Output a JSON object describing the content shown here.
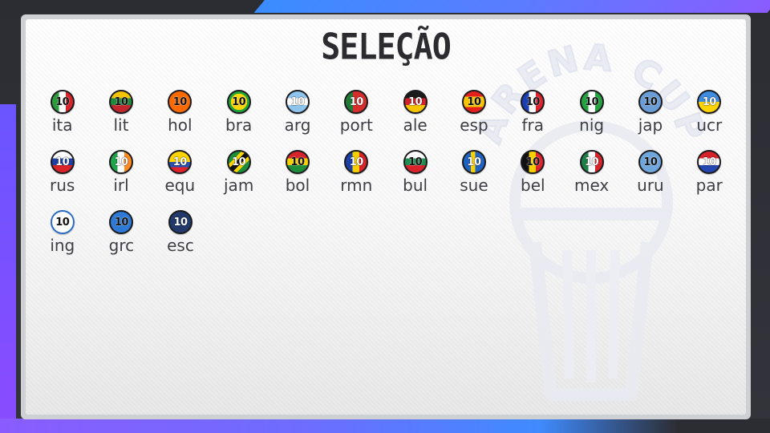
{
  "title": "SELEÇÃO",
  "watermark_text": "ARENA CUP",
  "teams": [
    {
      "code": "ita",
      "number": "10",
      "flag": "linear-gradient(90deg,#2a9d3a 0 33%,#ffffff 33% 66%,#d8232a 66%)",
      "light": false
    },
    {
      "code": "lit",
      "number": "10",
      "flag": "linear-gradient(180deg,#f5c400 0 33%,#1e8a3a 33% 66%,#c1272d 66%)",
      "light": false
    },
    {
      "code": "hol",
      "number": "10",
      "flag": "linear-gradient(180deg,#ff6a00 0 100%)",
      "light": false
    },
    {
      "code": "bra",
      "number": "10",
      "flag": "radial-gradient(circle,#ffd400 0 55%,#1fa53a 56%)",
      "light": false
    },
    {
      "code": "arg",
      "number": "10",
      "flag": "linear-gradient(180deg,#8fc4ec 0 33%,#ffffff 33% 66%,#8fc4ec 66%)",
      "light": true
    },
    {
      "code": "port",
      "number": "10",
      "flag": "linear-gradient(90deg,#1e7a35 0 35%,#d62f2b 35%)",
      "light": true
    },
    {
      "code": "ale",
      "number": "10",
      "flag": "linear-gradient(180deg,#1a1a1a 0 33%,#d42128 33% 66%,#f7c500 66%)",
      "light": true
    },
    {
      "code": "esp",
      "number": "10",
      "flag": "linear-gradient(180deg,#e3201b 0 25%,#f7c600 25% 75%,#e3201b 75%)",
      "light": false
    },
    {
      "code": "fra",
      "number": "10",
      "flag": "linear-gradient(90deg,#1a3fb4 0 33%,#ffffff 33% 66%,#e0232b 66%)",
      "light": false
    },
    {
      "code": "nig",
      "number": "10",
      "flag": "linear-gradient(90deg,#23a33f 0 33%,#ffffff 33% 66%,#23a33f 66%)",
      "light": false
    },
    {
      "code": "jap",
      "number": "10",
      "flag": "linear-gradient(180deg,#6b9ed6 0 100%)",
      "light": false
    },
    {
      "code": "ucr",
      "number": "10",
      "flag": "linear-gradient(180deg,#3d8ce0 0 50%,#ffd400 50%)",
      "light": true
    },
    {
      "code": "rus",
      "number": "10",
      "flag": "linear-gradient(180deg,#ffffff 0 33%,#1c3fa8 33% 66%,#d8232a 66%)",
      "light": true
    },
    {
      "code": "irl",
      "number": "10",
      "flag": "linear-gradient(90deg,#1fa54a 0 33%,#ffffff 33% 66%,#ff8a1f 66%)",
      "light": true
    },
    {
      "code": "equ",
      "number": "10",
      "flag": "linear-gradient(180deg,#ffd400 0 50%,#2750b0 50% 75%,#e0232b 75%)",
      "light": true
    },
    {
      "code": "jam",
      "number": "10",
      "flag": "linear-gradient(135deg,#1d8f3a 0 30%,#ffd400 30% 42%,#111 42% 58%,#ffd400 58% 70%,#1d8f3a 70%)",
      "light": true
    },
    {
      "code": "bol",
      "number": "10",
      "flag": "linear-gradient(180deg,#d8232a 0 33%,#f7d000 33% 66%,#1f8e3a 66%)",
      "light": false
    },
    {
      "code": "rmn",
      "number": "10",
      "flag": "linear-gradient(90deg,#1a3fa8 0 33%,#f7d000 33% 66%,#d8232a 66%)",
      "light": true
    },
    {
      "code": "bul",
      "number": "10",
      "flag": "linear-gradient(180deg,#ffffff 0 33%,#1b8f4f 33% 66%,#d8232a 66%)",
      "light": false
    },
    {
      "code": "sue",
      "number": "10",
      "flag": "linear-gradient(90deg,#1f64c2 0 35%,#ffd000 35% 55%,#1f64c2 55%)",
      "light": true
    },
    {
      "code": "bel",
      "number": "10",
      "flag": "linear-gradient(90deg,#111 0 33%,#f7d000 33% 66%,#e0232b 66%)",
      "light": false
    },
    {
      "code": "mex",
      "number": "10",
      "flag": "linear-gradient(90deg,#1c7f45 0 33%,#ffffff 33% 66%,#d8232a 66%)",
      "light": true
    },
    {
      "code": "uru",
      "number": "10",
      "flag": "linear-gradient(180deg,#6fa6dc 0 100%)",
      "light": false
    },
    {
      "code": "par",
      "number": "10",
      "flag": "linear-gradient(180deg,#d8232a 0 33%,#ffffff 33% 66%,#2448b0 66%)",
      "light": true
    },
    {
      "code": "ing",
      "number": "10",
      "flag": "linear-gradient(180deg,#ffffff 0 100%)",
      "light": false
    },
    {
      "code": "grc",
      "number": "10",
      "flag": "linear-gradient(180deg,#2d79d3 0 100%)",
      "light": false
    },
    {
      "code": "esc",
      "number": "10",
      "flag": "linear-gradient(180deg,#223a6b 0 100%)",
      "light": true
    }
  ],
  "ring_colors": {
    "ing": "#2a6cc6"
  }
}
